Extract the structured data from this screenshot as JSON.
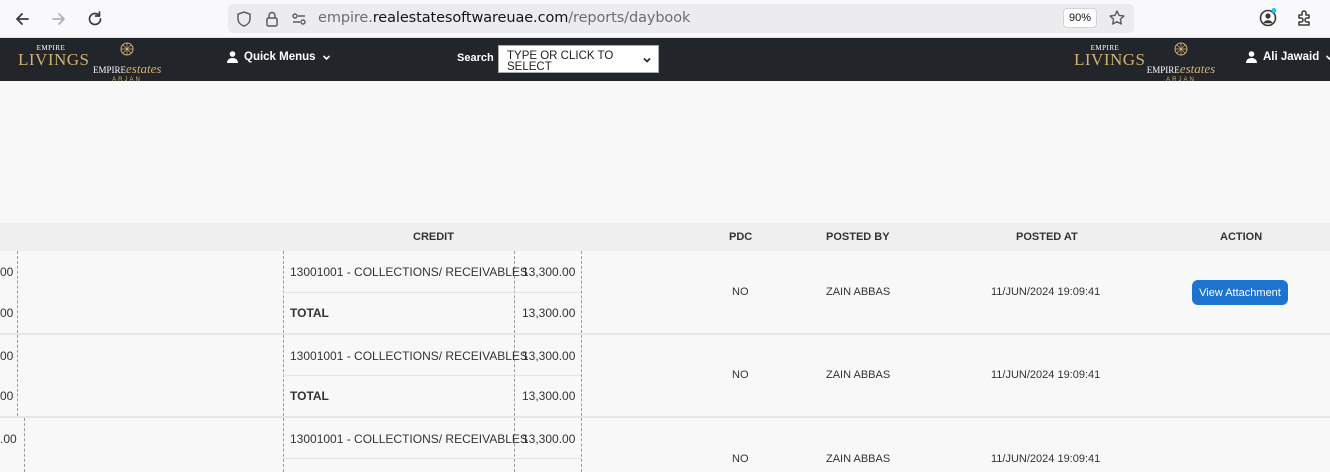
{
  "browser": {
    "url_prefix": "empire.",
    "url_host": "realestatesoftwareuae.com",
    "url_path": "/reports/daybook",
    "zoom": "90%"
  },
  "navbar": {
    "logo_left": {
      "empire": "EMPIRE",
      "livings": "LIVINGS"
    },
    "logo_estates": {
      "empire": "EMPIRE",
      "estates": "estates",
      "arjan": "ARJAN"
    },
    "quick_menus": "Quick Menus",
    "search_label": "Search",
    "search_placeholder": "TYPE OR CLICK TO SELECT",
    "user_name": "Ali Jawaid"
  },
  "table": {
    "headers": {
      "credit": "CREDIT",
      "pdc": "PDC",
      "posted_by": "POSTED BY",
      "posted_at": "POSTED AT",
      "action": "ACTION"
    },
    "rows": [
      {
        "left_amount_1": "00",
        "left_amount_2": "00",
        "credit_account": "13001001 - COLLECTIONS/ RECEIVABLES",
        "credit_amount": "13,300.00",
        "total_label": "TOTAL",
        "total_amount": "13,300.00",
        "pdc": "NO",
        "posted_by": "ZAIN ABBAS",
        "posted_at": "11/JUN/2024 19:09:41",
        "action": "View Attachment"
      },
      {
        "left_amount_1": "00",
        "left_amount_2": "00",
        "credit_account": "13001001 - COLLECTIONS/ RECEIVABLES",
        "credit_amount": "13,300.00",
        "total_label": "TOTAL",
        "total_amount": "13,300.00",
        "pdc": "NO",
        "posted_by": "ZAIN ABBAS",
        "posted_at": "11/JUN/2024 19:09:41"
      },
      {
        "left_amount_1": ".00",
        "credit_account": "13001001 - COLLECTIONS/ RECEIVABLES",
        "credit_amount": "13,300.00",
        "pdc": "NO",
        "posted_by": "ZAIN ABBAS",
        "posted_at": "11/JUN/2024 19:09:41"
      }
    ]
  }
}
